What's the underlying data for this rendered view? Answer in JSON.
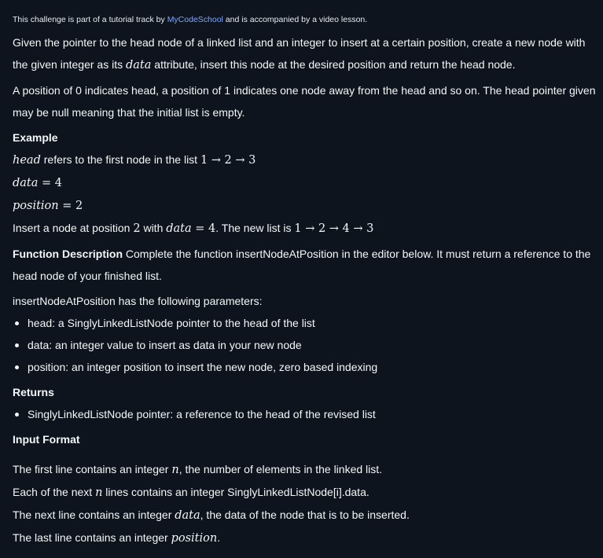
{
  "tutorial": {
    "prefix": "This challenge is part of a tutorial track by ",
    "link": "MyCodeSchool",
    "suffix": " and is accompanied by a video lesson."
  },
  "intro": {
    "p1_a": "Given the pointer to the head node of a linked list and an integer to insert at a certain position, create a new node with the given integer as its ",
    "p1_math": "data",
    "p1_b": " attribute, insert this node at the desired position and return the head node.",
    "p2": "A position of 0 indicates head, a position of 1 indicates one node away from the head and so on. The head pointer given may be null meaning that the initial list is empty."
  },
  "example": {
    "heading": "Example",
    "head_math": "head",
    "head_text": " refers to the first node in the list ",
    "head_list": "1 → 2 → 3",
    "data_math": "data",
    "data_eq": " = 4",
    "position_math": "position",
    "position_eq": " = 2",
    "insert_a": "Insert a node at position ",
    "insert_pos": "2",
    "insert_b": " with ",
    "insert_math": "data",
    "insert_eq": " = 4",
    "insert_c": ". The new list is ",
    "insert_list": "1 → 2 → 4 → 3"
  },
  "function_description": {
    "heading": "Function Description",
    "text": " Complete the function insertNodeAtPosition in the editor below. It must return a reference to the head node of your finished list.",
    "params_intro": "insertNodeAtPosition has the following parameters:",
    "params": [
      "head: a SinglyLinkedListNode pointer to the head of the list",
      "data: an integer value to insert as data in your new node",
      "position: an integer position to insert the new node, zero based indexing"
    ]
  },
  "returns": {
    "heading": "Returns",
    "items": [
      "SinglyLinkedListNode pointer: a reference to the head of the revised list"
    ]
  },
  "input_format": {
    "heading": "Input Format",
    "line1_a": "The first line contains an integer ",
    "line1_math": "n",
    "line1_b": ", the number of elements in the linked list.",
    "line2_a": "Each of the next ",
    "line2_math": "n",
    "line2_b": " lines contains an integer SinglyLinkedListNode[i].data.",
    "line3_a": "The next line contains an integer ",
    "line3_math": "data",
    "line3_b": ", the data of the node that is to be inserted.",
    "line4_a": "The last line contains an integer ",
    "line4_math": "position",
    "line4_b": "."
  }
}
